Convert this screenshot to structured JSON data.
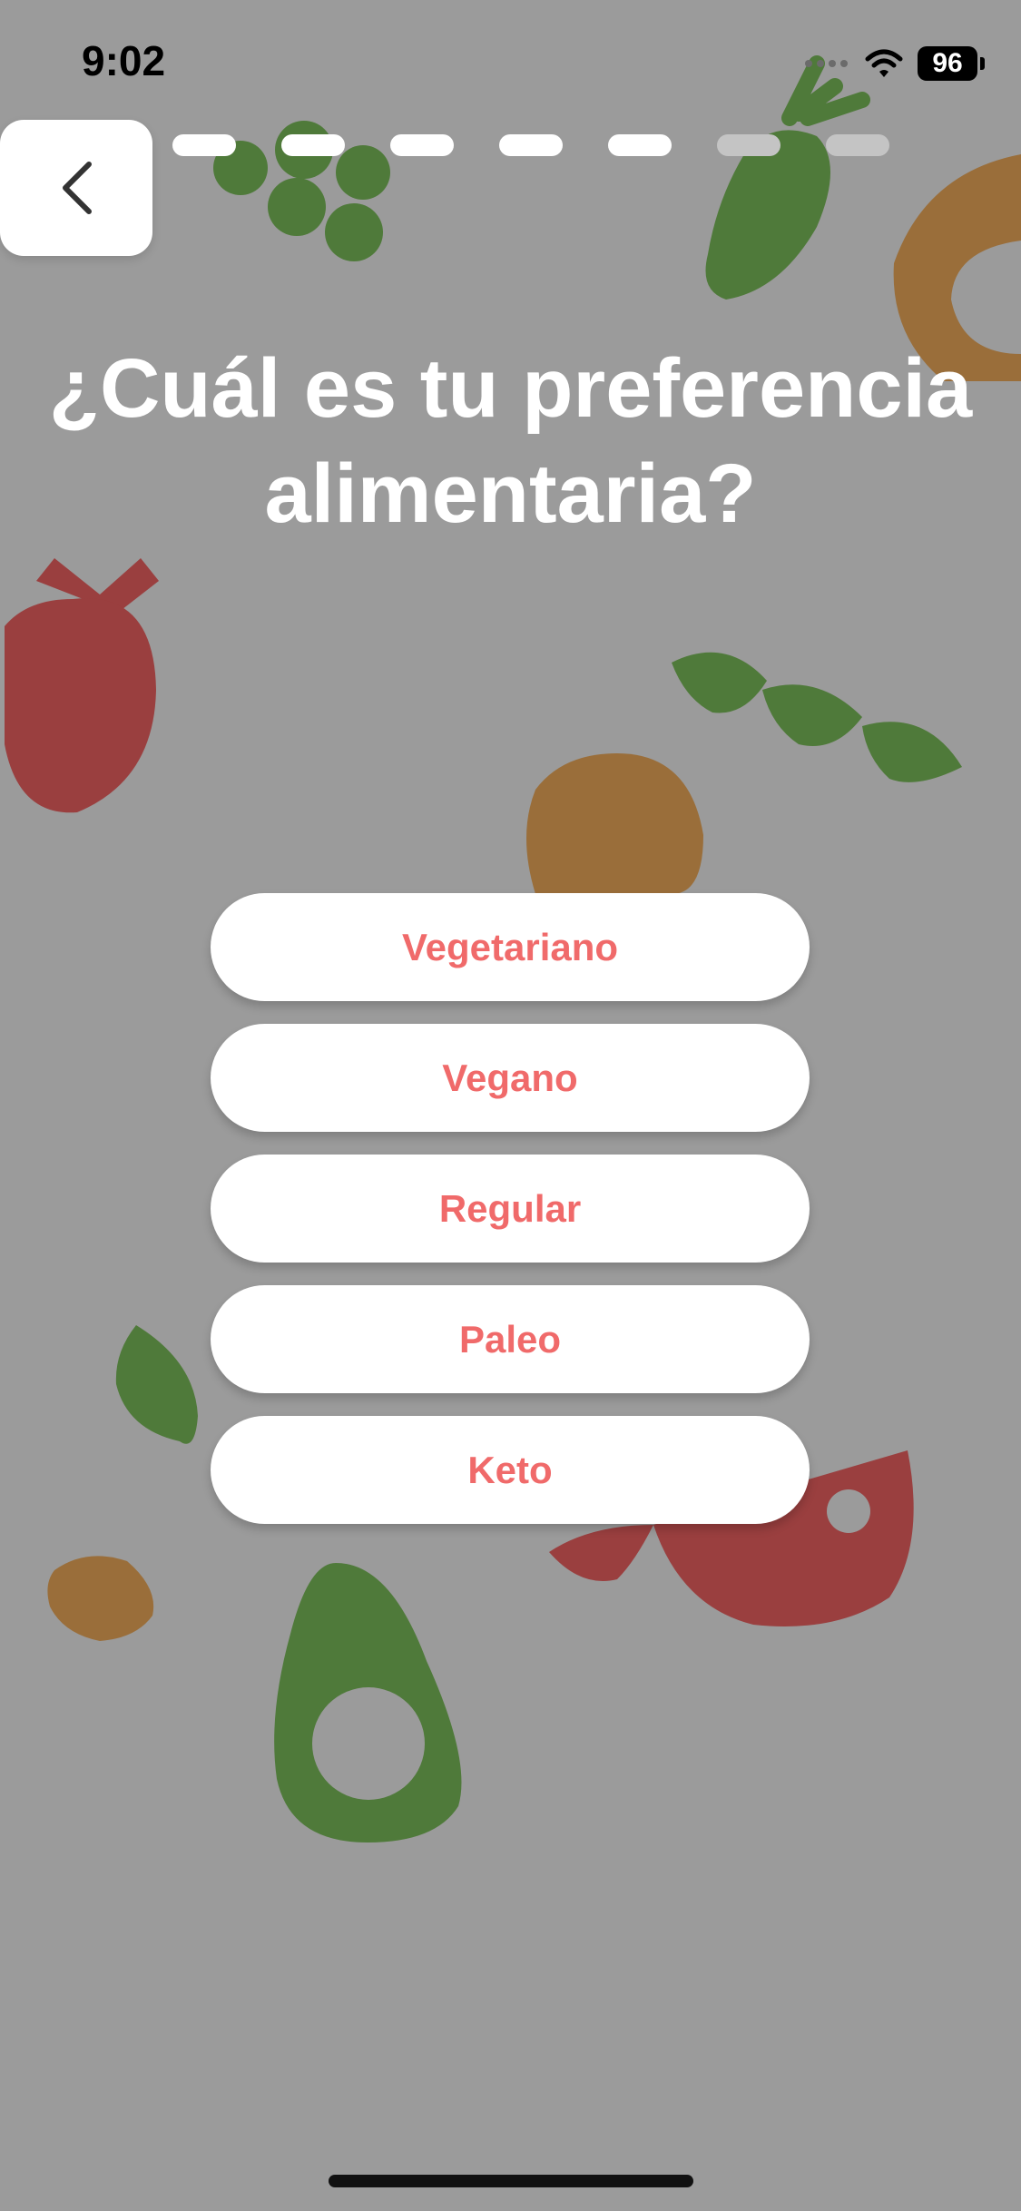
{
  "status_bar": {
    "time": "9:02",
    "battery": "96",
    "icons": [
      "cellular-icon",
      "wifi-icon",
      "battery-icon"
    ]
  },
  "navigation": {
    "back_icon": "chevron-left-icon",
    "progress_total": 8,
    "progress_completed": 6
  },
  "question": {
    "title": "¿Cuál es tu preferencia alimentaria?"
  },
  "options": [
    {
      "label": "Vegetariano"
    },
    {
      "label": "Vegano"
    },
    {
      "label": "Regular"
    },
    {
      "label": "Paleo"
    },
    {
      "label": "Keto"
    }
  ],
  "colors": {
    "background": "#9b9b9b",
    "option_text": "#f06a6a",
    "green": "#4f7a3a",
    "red": "#9a3f3f",
    "orange": "#9a6e3a"
  }
}
